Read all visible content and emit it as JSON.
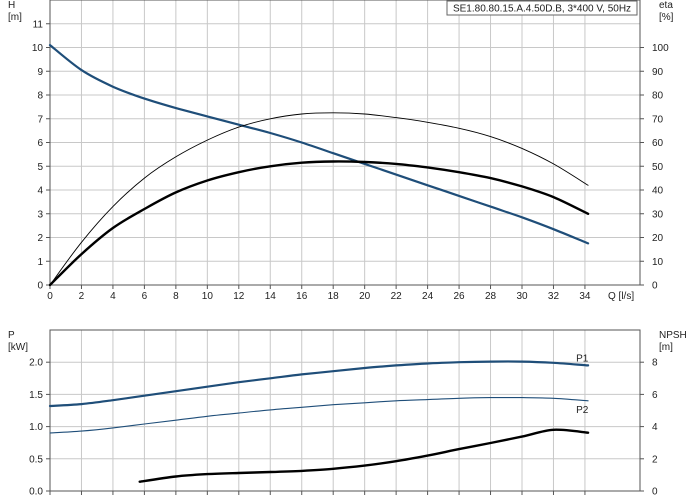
{
  "chart_data": [
    {
      "type": "line",
      "title": "SE1.80.80.15.A.4.50D.B, 3*400 V, 50Hz",
      "xlabel": "Q [l/s]",
      "ylabel_left_line1": "H",
      "ylabel_left_line2": "[m]",
      "ylabel_right_line1": "eta",
      "ylabel_right_line2": "[%]",
      "xlim": [
        0,
        37.5
      ],
      "ylim_left": [
        0,
        12
      ],
      "ylim_right": [
        0,
        120
      ],
      "x_ticks": [
        0,
        2,
        4,
        6,
        8,
        10,
        12,
        14,
        16,
        18,
        20,
        22,
        24,
        26,
        28,
        30,
        32,
        34
      ],
      "x_ticks_labeled": [
        0,
        2,
        4,
        6,
        8,
        10,
        12,
        14,
        16,
        18,
        20,
        22,
        24,
        26,
        28,
        30,
        32,
        34
      ],
      "x_tick_labels": [
        "0",
        "2",
        "4",
        "6",
        "8",
        "10",
        "12",
        "14",
        "16",
        "18",
        "20",
        "22",
        "24",
        "26",
        "28",
        "30",
        "32",
        "34"
      ],
      "y_ticks_left": [
        0,
        1,
        2,
        3,
        4,
        5,
        6,
        7,
        8,
        9,
        10,
        11
      ],
      "y_tick_labels_left": [
        "0",
        "1",
        "2",
        "3",
        "4",
        "5",
        "6",
        "7",
        "8",
        "9",
        "10",
        "11"
      ],
      "y_ticks_right": [
        0,
        10,
        20,
        30,
        40,
        50,
        60,
        70,
        80,
        90,
        100
      ],
      "y_tick_labels_right": [
        "0",
        "10",
        "20",
        "30",
        "40",
        "50",
        "60",
        "70",
        "80",
        "90",
        "100"
      ],
      "grid": true,
      "series": [
        {
          "axis": "left",
          "color": "#1f4e79",
          "stroke": 2.2,
          "x": [
            0,
            2,
            4,
            6,
            8,
            10,
            12,
            14,
            16,
            18,
            20,
            22,
            24,
            26,
            28,
            30,
            32,
            34.2
          ],
          "values": [
            10.1,
            9.05,
            8.35,
            7.85,
            7.45,
            7.1,
            6.75,
            6.4,
            6.0,
            5.55,
            5.1,
            4.65,
            4.2,
            3.75,
            3.3,
            2.85,
            2.35,
            1.75
          ]
        },
        {
          "axis": "right",
          "color": "#000000",
          "stroke": 2.4,
          "x": [
            0,
            2,
            4,
            6,
            8,
            10,
            12,
            14,
            16,
            18,
            20,
            22,
            24,
            26,
            28,
            30,
            32,
            34.2
          ],
          "values": [
            0,
            13,
            24,
            32,
            39,
            44,
            47.5,
            50,
            51.5,
            52,
            51.8,
            51,
            49.5,
            47.5,
            45,
            41.5,
            37,
            30
          ]
        },
        {
          "axis": "right",
          "color": "#000000",
          "stroke": 0.9,
          "x": [
            0,
            2,
            4,
            6,
            8,
            10,
            12,
            14,
            16,
            18,
            20,
            22,
            24,
            26,
            28,
            30,
            32,
            34.2
          ],
          "values": [
            0,
            18,
            33,
            45,
            54,
            61,
            66.5,
            70,
            72,
            72.5,
            72,
            70.5,
            68.5,
            66,
            62.5,
            57.5,
            51,
            42
          ]
        }
      ]
    },
    {
      "type": "line",
      "ylabel_left_line1": "P",
      "ylabel_left_line2": "[kW]",
      "ylabel_right_line1": "NPSH",
      "ylabel_right_line2": "[m]",
      "xlim": [
        0,
        37.5
      ],
      "ylim_left": [
        0,
        2.5
      ],
      "ylim_right": [
        0,
        10
      ],
      "x_ticks": [
        0,
        2,
        4,
        6,
        8,
        10,
        12,
        14,
        16,
        18,
        20,
        22,
        24,
        26,
        28,
        30,
        32,
        34
      ],
      "y_ticks_left": [
        0,
        0.5,
        1.0,
        1.5,
        2.0
      ],
      "y_tick_labels_left": [
        "0.0",
        "0.5",
        "1.0",
        "1.5",
        "2.0"
      ],
      "y_ticks_right": [
        0,
        2,
        4,
        6,
        8
      ],
      "y_tick_labels_right": [
        "0",
        "2",
        "4",
        "6",
        "8"
      ],
      "grid": true,
      "series": [
        {
          "name": "P1",
          "axis": "left",
          "color": "#1f4e79",
          "stroke": 2.2,
          "x": [
            0,
            2,
            4,
            6,
            8,
            10,
            12,
            14,
            16,
            18,
            20,
            22,
            24,
            26,
            28,
            30,
            32,
            34.2
          ],
          "values": [
            1.32,
            1.35,
            1.41,
            1.48,
            1.55,
            1.62,
            1.69,
            1.75,
            1.81,
            1.86,
            1.91,
            1.95,
            1.98,
            2.0,
            2.01,
            2.01,
            1.99,
            1.95
          ]
        },
        {
          "name": "P2",
          "axis": "left",
          "color": "#1f4e79",
          "stroke": 1.1,
          "x": [
            0,
            2,
            4,
            6,
            8,
            10,
            12,
            14,
            16,
            18,
            20,
            22,
            24,
            26,
            28,
            30,
            32,
            34.2
          ],
          "values": [
            0.9,
            0.93,
            0.98,
            1.04,
            1.1,
            1.16,
            1.21,
            1.26,
            1.3,
            1.34,
            1.37,
            1.4,
            1.42,
            1.44,
            1.45,
            1.45,
            1.44,
            1.4
          ]
        },
        {
          "axis": "right",
          "color": "#000000",
          "stroke": 2.4,
          "x": [
            5.7,
            8,
            10,
            12,
            14,
            16,
            18,
            20,
            22,
            24,
            26,
            28,
            30,
            32,
            34.2
          ],
          "values": [
            0.58,
            0.9,
            1.05,
            1.12,
            1.18,
            1.25,
            1.38,
            1.58,
            1.85,
            2.2,
            2.6,
            2.98,
            3.38,
            3.8,
            3.62
          ]
        }
      ],
      "series_labels": [
        "P1",
        "P2"
      ]
    }
  ]
}
